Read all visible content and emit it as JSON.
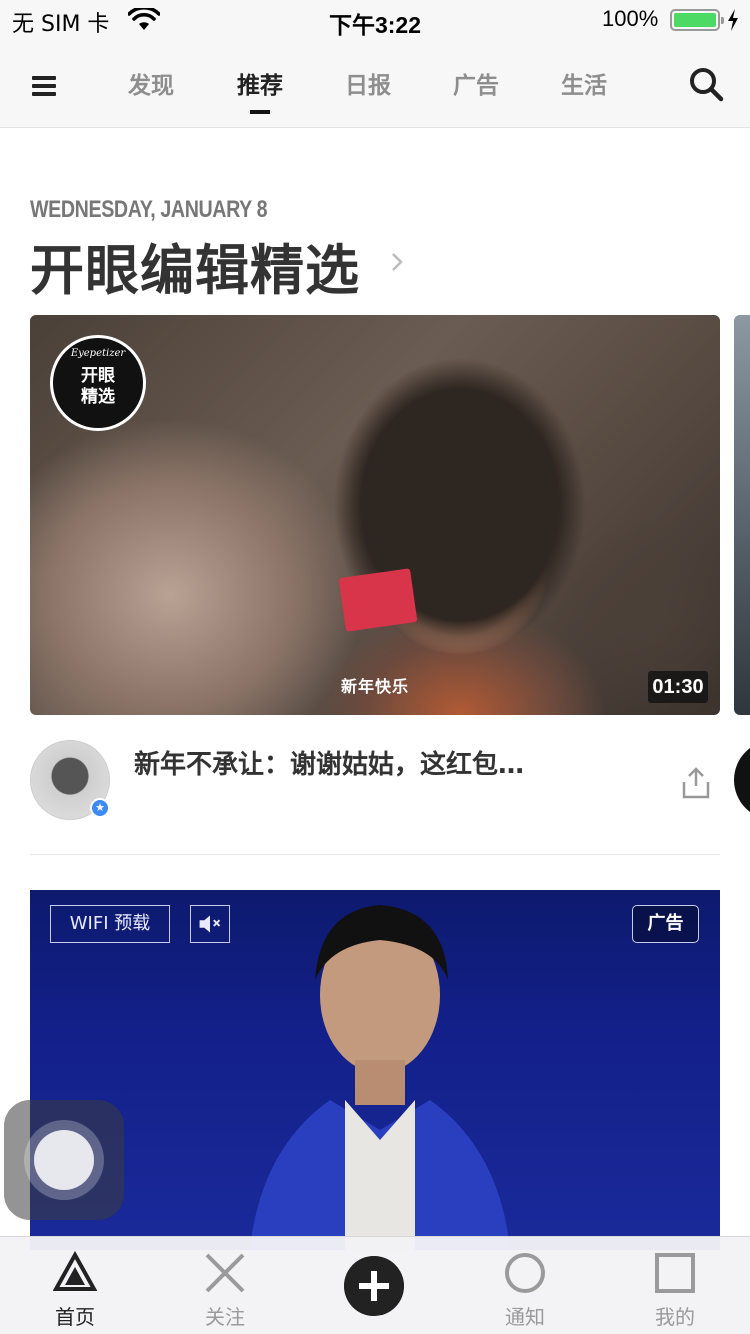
{
  "status_bar": {
    "carrier": "无 SIM 卡",
    "time": "下午3:22",
    "battery": "100%"
  },
  "nav": {
    "tabs": [
      {
        "label": "发现",
        "active": false
      },
      {
        "label": "推荐",
        "active": true
      },
      {
        "label": "日报",
        "active": false
      },
      {
        "label": "广告",
        "active": false
      },
      {
        "label": "生活",
        "active": false
      }
    ]
  },
  "header": {
    "date": "WEDNESDAY, JANUARY 8",
    "title": "开眼编辑精选"
  },
  "video": {
    "badge_brand": "Eyepetizer",
    "badge_text_line1": "开眼",
    "badge_text_line2": "精选",
    "subtitle": "新年快乐",
    "duration": "01:30",
    "title": "新年不承让：谢谢姑姑，这红包…"
  },
  "ad": {
    "wifi_tag": "WIFI 预载",
    "ad_label": "广告"
  },
  "tab_bar": {
    "items": [
      {
        "label": "首页",
        "active": true
      },
      {
        "label": "关注",
        "active": false
      },
      {
        "label": "通知",
        "active": false
      },
      {
        "label": "我的",
        "active": false
      }
    ]
  },
  "colors": {
    "battery_green": "#4cd964",
    "ad_background": "#13208a",
    "verified_blue": "#3d8bf0"
  }
}
